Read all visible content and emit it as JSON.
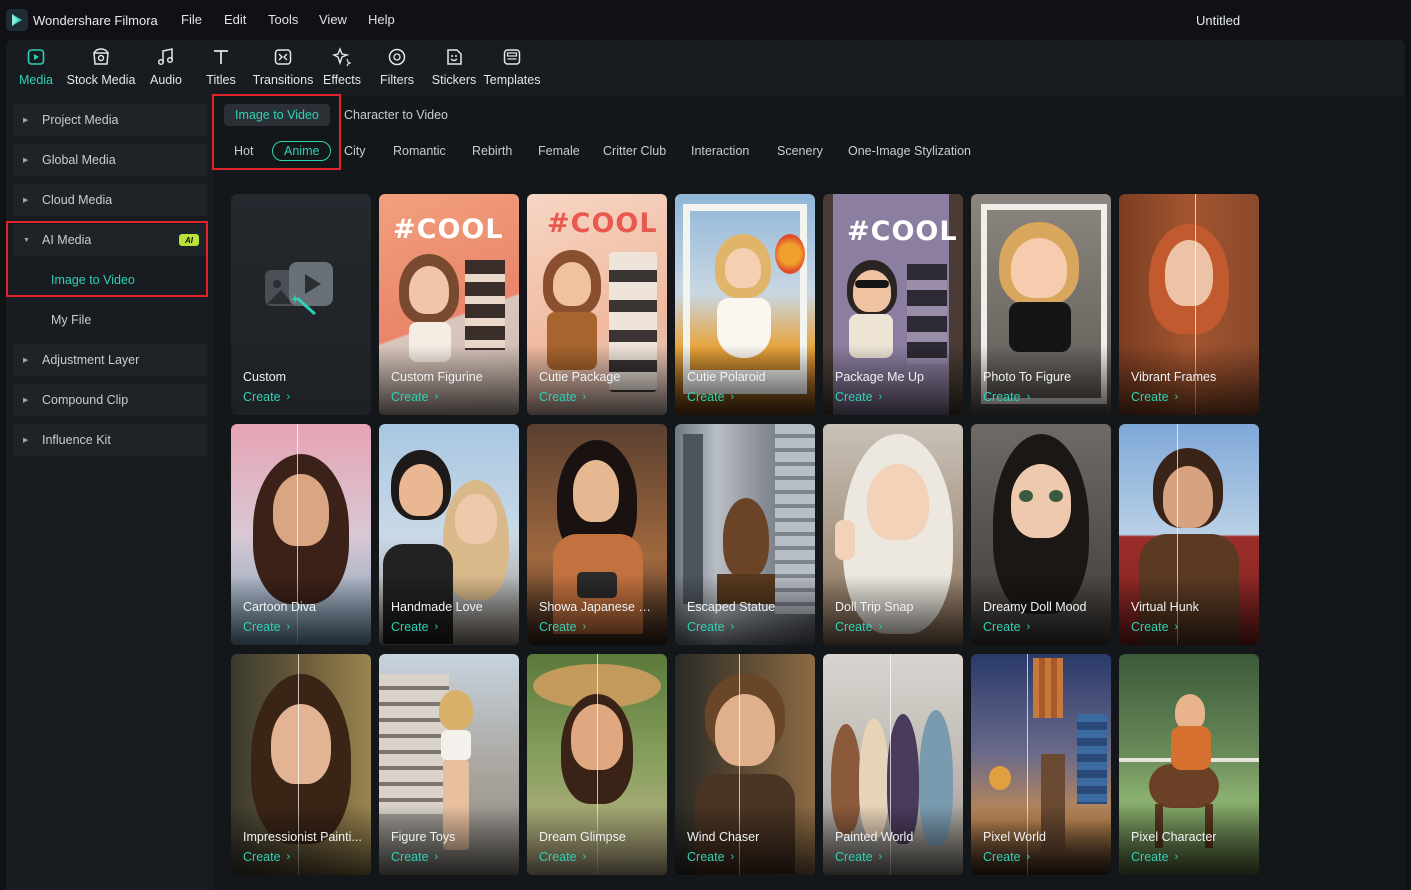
{
  "app": {
    "name": "Wondershare Filmora",
    "doc_title": "Untitled",
    "menu": [
      "File",
      "Edit",
      "Tools",
      "View",
      "Help"
    ],
    "accent": "#2fd1b5"
  },
  "toolbar": {
    "tools": [
      {
        "label": "Media",
        "icon": "media-icon",
        "active": true
      },
      {
        "label": "Stock Media",
        "icon": "stock-media-icon"
      },
      {
        "label": "Audio",
        "icon": "music-note-icon"
      },
      {
        "label": "Titles",
        "icon": "text-t-icon"
      },
      {
        "label": "Transitions",
        "icon": "transitions-icon"
      },
      {
        "label": "Effects",
        "icon": "effects-sparkle-icon"
      },
      {
        "label": "Filters",
        "icon": "filters-icon"
      },
      {
        "label": "Stickers",
        "icon": "stickers-icon"
      },
      {
        "label": "Templates",
        "icon": "templates-icon"
      }
    ]
  },
  "sidebar": {
    "items": [
      {
        "label": "Project Media"
      },
      {
        "label": "Global Media"
      },
      {
        "label": "Cloud Media"
      },
      {
        "label": "AI Media",
        "expanded": true,
        "badge": "AI"
      },
      {
        "label": "Adjustment Layer"
      },
      {
        "label": "Compound Clip"
      },
      {
        "label": "Influence Kit"
      }
    ],
    "ai_sub": [
      {
        "label": "Image to Video",
        "active": true
      },
      {
        "label": "My File"
      }
    ]
  },
  "main": {
    "modes": [
      {
        "label": "Image to Video",
        "active": true
      },
      {
        "label": "Character to Video"
      }
    ],
    "categories": [
      {
        "label": "Hot"
      },
      {
        "label": "Anime",
        "active": true
      },
      {
        "label": "City"
      },
      {
        "label": "Romantic"
      },
      {
        "label": "Rebirth"
      },
      {
        "label": "Female"
      },
      {
        "label": "Critter Club"
      },
      {
        "label": "Interaction"
      },
      {
        "label": "Scenery"
      },
      {
        "label": "One-Image Stylization"
      }
    ],
    "create_label": "Create",
    "cool_text": "#COOL",
    "cards": [
      {
        "name": "Custom",
        "theme": "custom"
      },
      {
        "name": "Custom Figurine",
        "theme": "coral-box"
      },
      {
        "name": "Cutie Package",
        "theme": "peach-box"
      },
      {
        "name": "Cutie Polaroid",
        "theme": "polaroid"
      },
      {
        "name": "Package Me Up",
        "theme": "purple-box"
      },
      {
        "name": "Photo To Figure",
        "theme": "figure"
      },
      {
        "name": "Vibrant Frames",
        "theme": "redhead-split"
      },
      {
        "name": "Cartoon Diva",
        "theme": "diva-split"
      },
      {
        "name": "Handmade Love",
        "theme": "couple"
      },
      {
        "name": "Showa Japanese Co...",
        "theme": "showa"
      },
      {
        "name": "Escaped Statue",
        "theme": "statue"
      },
      {
        "name": "Doll Trip Snap",
        "theme": "doll-blonde"
      },
      {
        "name": "Dreamy Doll Mood",
        "theme": "doll-dark"
      },
      {
        "name": "Virtual Hunk",
        "theme": "hunk-split"
      },
      {
        "name": "Impressionist Painti...",
        "theme": "impression-split"
      },
      {
        "name": "Figure Toys",
        "theme": "toys"
      },
      {
        "name": "Dream Glimpse",
        "theme": "glimpse-split"
      },
      {
        "name": "Wind Chaser",
        "theme": "wind-split"
      },
      {
        "name": "Painted World",
        "theme": "painted-split"
      },
      {
        "name": "Pixel World",
        "theme": "pixel-split"
      },
      {
        "name": "Pixel Character",
        "theme": "pixel-rider"
      }
    ]
  }
}
